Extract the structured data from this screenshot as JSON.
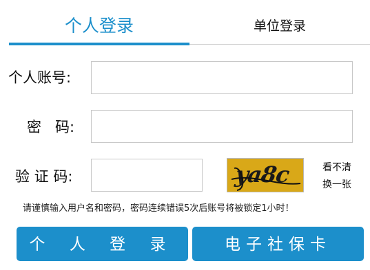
{
  "colors": {
    "accent": "#1c8fcb",
    "tab_active_text": "#1c8fcb",
    "captcha_bg": "#d9a818"
  },
  "tabs": [
    {
      "label": "个人登录",
      "active": true
    },
    {
      "label": "单位登录",
      "active": false
    }
  ],
  "form": {
    "account_label": "个人账号:",
    "account_value": "",
    "password_label": "密   码:",
    "password_value": "",
    "captcha_label": "验 证 码:",
    "captcha_value": "",
    "captcha_image_text": "ya8c",
    "refresh_line1": "看不清",
    "refresh_line2": "换一张"
  },
  "notice": "请谨慎输入用户名和密码，密码连续错误5次后账号将被锁定1小时！",
  "buttons": {
    "personal_login": "个 人 登 录",
    "social_card": "电子社保卡"
  }
}
